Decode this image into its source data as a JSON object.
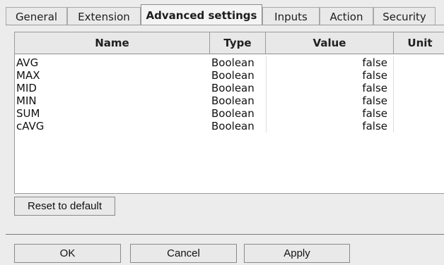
{
  "tabs": [
    {
      "label": "General"
    },
    {
      "label": "Extension"
    },
    {
      "label": "Advanced settings"
    },
    {
      "label": "Inputs"
    },
    {
      "label": "Action"
    },
    {
      "label": "Security"
    }
  ],
  "table": {
    "columns": [
      "Name",
      "Type",
      "Value",
      "Unit"
    ],
    "rows": [
      {
        "name": "AVG",
        "type": "Boolean",
        "value": "false",
        "unit": ""
      },
      {
        "name": "MAX",
        "type": "Boolean",
        "value": "false",
        "unit": ""
      },
      {
        "name": "MID",
        "type": "Boolean",
        "value": "false",
        "unit": ""
      },
      {
        "name": "MIN",
        "type": "Boolean",
        "value": "false",
        "unit": ""
      },
      {
        "name": "SUM",
        "type": "Boolean",
        "value": "false",
        "unit": ""
      },
      {
        "name": "cAVG",
        "type": "Boolean",
        "value": "false",
        "unit": ""
      }
    ]
  },
  "actions": {
    "reset_label": "Reset to default",
    "ok_label": "OK",
    "cancel_label": "Cancel",
    "apply_label": "Apply"
  }
}
